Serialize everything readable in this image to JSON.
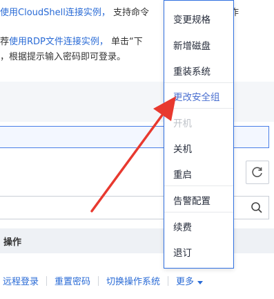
{
  "info": {
    "line1_link": "使用CloudShell连接实例，",
    "line1_text": "支持命令",
    "line1_tail": "作",
    "line2_prefix": "荐",
    "line2_link": "使用RDP文件连接实例，",
    "line2_text": "单击“下",
    "line3_text": "，根据提示输入密码即可登录。"
  },
  "table": {
    "header_operation": "操作"
  },
  "row_actions": {
    "remote_login": "远程登录",
    "reset_password": "重置密码",
    "switch_os": "切换操作系统",
    "more": "更多"
  },
  "menu": {
    "items": [
      {
        "label": "变更规格",
        "state": "normal"
      },
      {
        "label": "新增磁盘",
        "state": "normal"
      },
      {
        "label": "重装系统",
        "state": "normal"
      },
      {
        "label": "更改安全组",
        "state": "active"
      },
      {
        "label": "开机",
        "state": "disabled"
      },
      {
        "label": "关机",
        "state": "normal"
      },
      {
        "label": "重启",
        "state": "normal"
      },
      {
        "label": "告警配置",
        "state": "normal"
      },
      {
        "label": "续费",
        "state": "normal"
      },
      {
        "label": "退订",
        "state": "normal"
      }
    ]
  },
  "colors": {
    "link": "#2a6bd6",
    "menu_border": "#2f6fe0",
    "arrow": "#e8392f",
    "active_item": "#4a6fd0",
    "disabled_item": "#bfc3c9"
  },
  "icons": {
    "refresh": "refresh-icon",
    "search": "search-icon",
    "more_caret": "caret-down-icon"
  }
}
